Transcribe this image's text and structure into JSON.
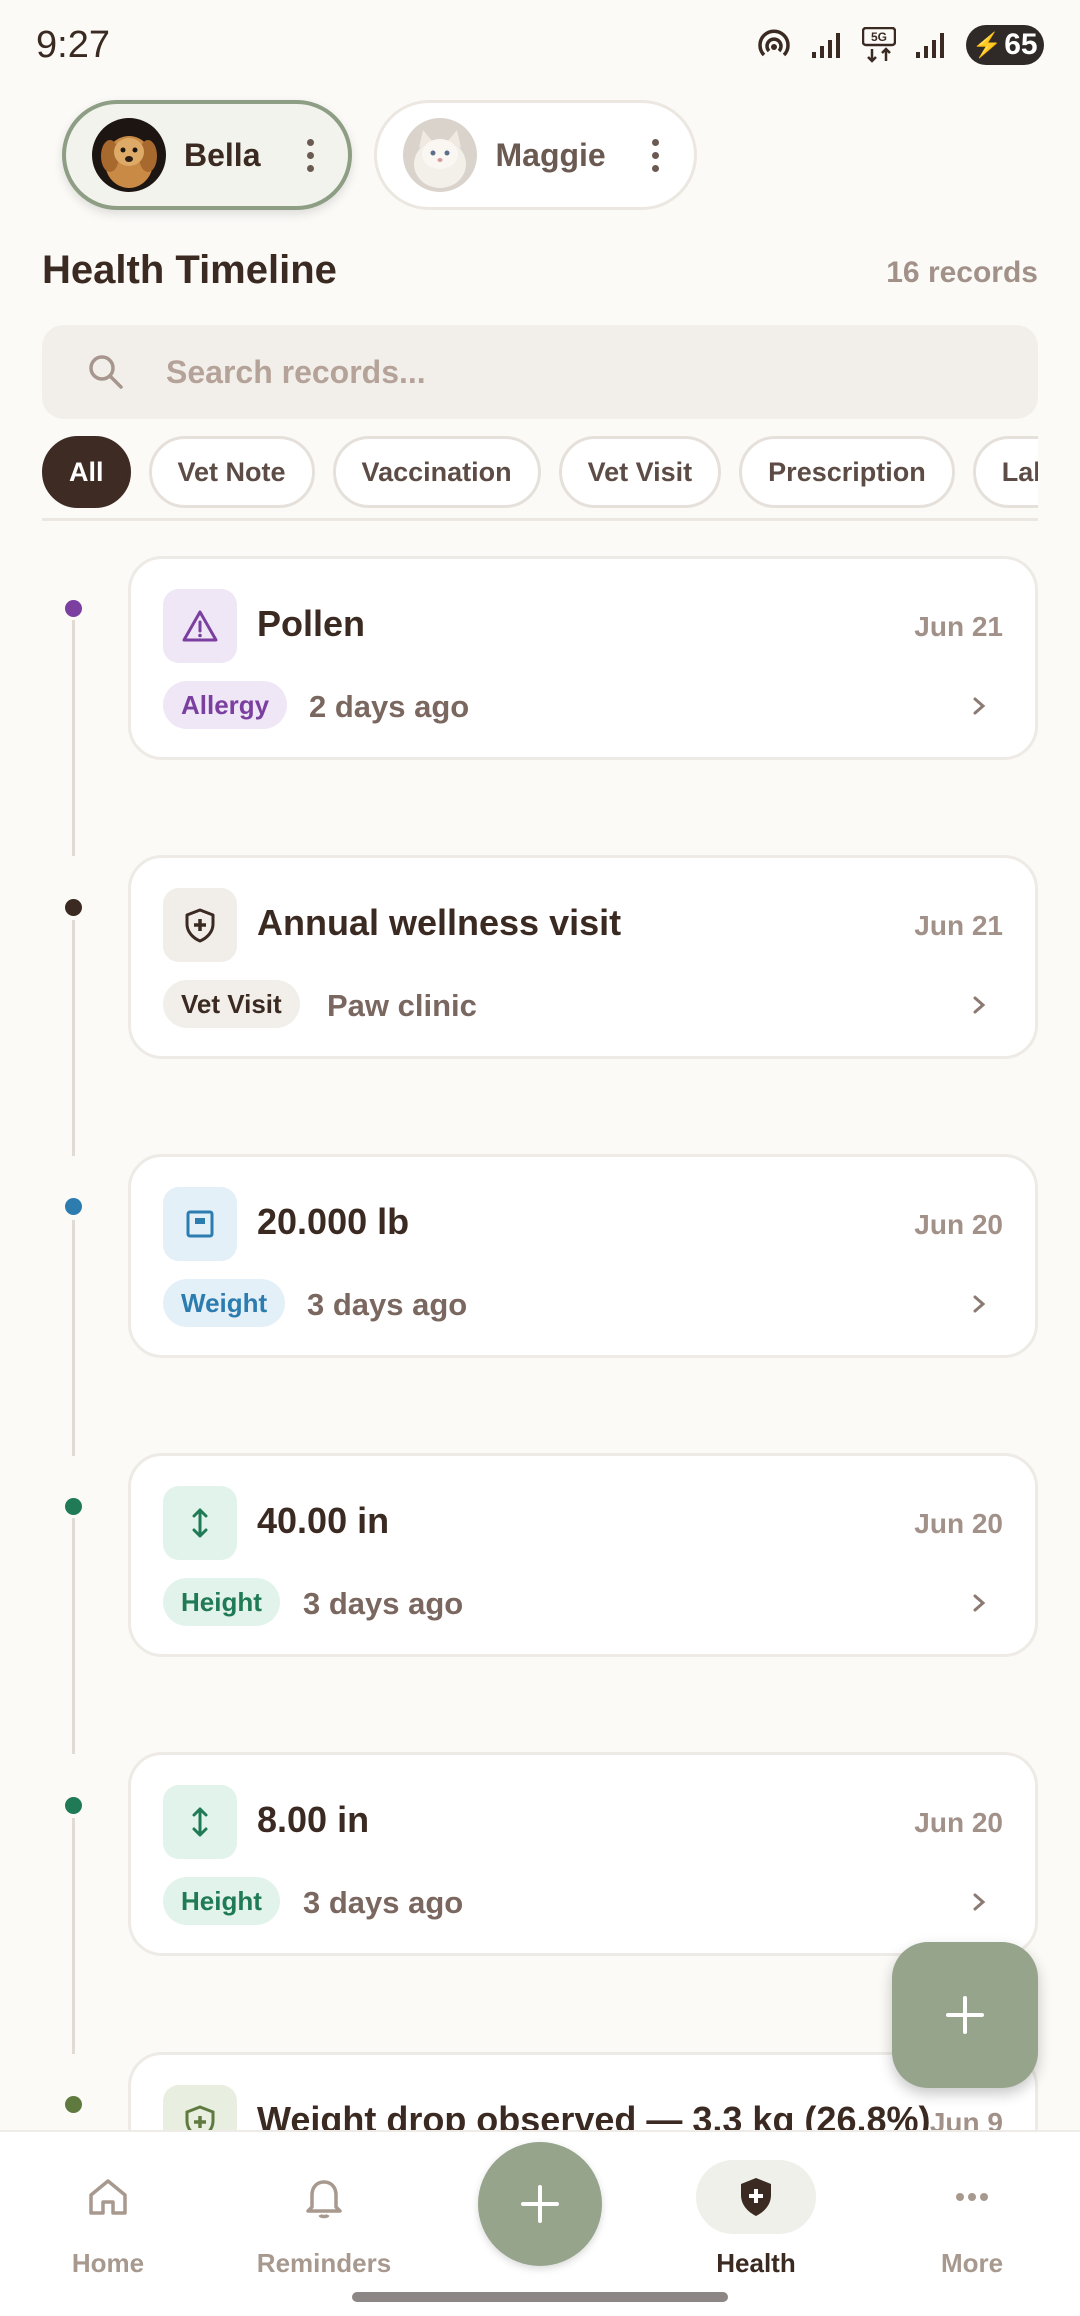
{
  "status_bar": {
    "time": "9:27",
    "battery": "65"
  },
  "pets": [
    {
      "name": "Bella",
      "active": true
    },
    {
      "name": "Maggie",
      "active": false
    }
  ],
  "timeline": {
    "title": "Health Timeline",
    "count": "16 records"
  },
  "search": {
    "placeholder": "Search records..."
  },
  "filters": [
    "All",
    "Vet Note",
    "Vaccination",
    "Vet Visit",
    "Prescription",
    "Lab R"
  ],
  "records": [
    {
      "title": "Pollen",
      "date": "Jun 21",
      "tag": "Allergy",
      "sub": "2 days ago",
      "icon": "warning-icon"
    },
    {
      "title": "Annual wellness visit",
      "date": "Jun 21",
      "tag": "Vet Visit",
      "sub": "Paw clinic",
      "icon": "shield-icon"
    },
    {
      "title": "20.000 lb",
      "date": "Jun 20",
      "tag": "Weight",
      "sub": "3 days ago",
      "icon": "scale-icon"
    },
    {
      "title": "40.00 in",
      "date": "Jun 20",
      "tag": "Height",
      "sub": "3 days ago",
      "icon": "height-icon"
    },
    {
      "title": "8.00 in",
      "date": "Jun 20",
      "tag": "Height",
      "sub": "3 days ago",
      "icon": "height-icon"
    },
    {
      "title": "Weight drop observed — 3.3 kg (26.8%)",
      "date": "Jun 9",
      "icon": "medical-icon"
    }
  ],
  "nav": {
    "home": "Home",
    "reminders": "Reminders",
    "health": "Health",
    "more": "More"
  },
  "colors": {
    "accent": "#96a48c",
    "allergy": "#7b3fa0",
    "vet_visit": "#3b2a22",
    "weight": "#2c7cb0",
    "height": "#1f7a55",
    "note": "#5f7a3f"
  }
}
